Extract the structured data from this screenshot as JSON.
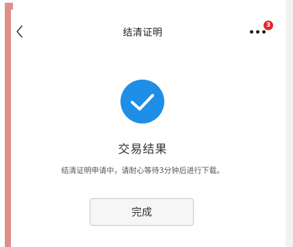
{
  "nav": {
    "title": "结清证明",
    "back_icon": "chevron-left-icon",
    "more_icon": "more-horizontal-icon",
    "badge_count": "3"
  },
  "result": {
    "icon": "check-circle-icon",
    "title": "交易结果",
    "description": "结清证明申请中，请耐心等待3分钟后进行下载。"
  },
  "actions": {
    "done_label": "完成"
  },
  "colors": {
    "accent": "#1e8ee6",
    "badge": "#e5262b",
    "side_marker": "#e08f88"
  }
}
